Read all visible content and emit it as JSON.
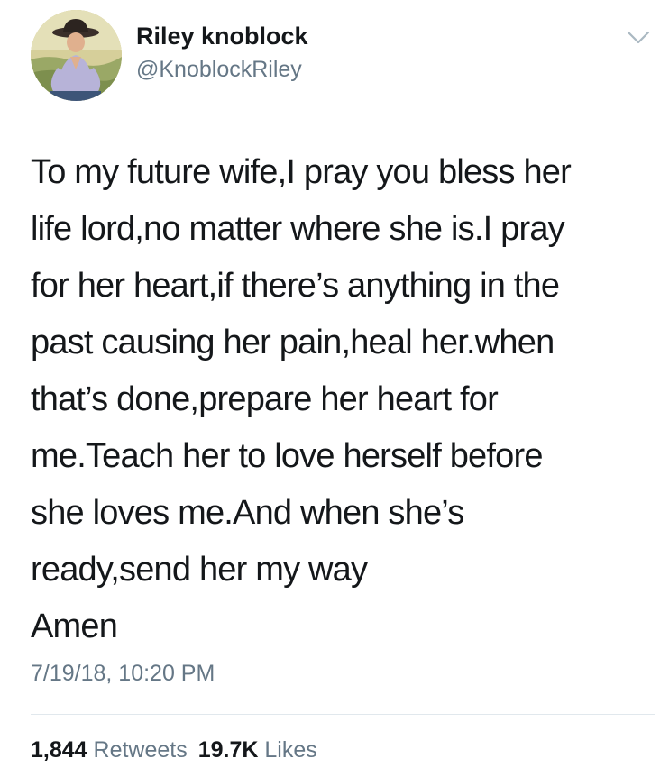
{
  "tweet": {
    "author_name": "Riley knoblock",
    "author_handle": "@KnoblockRiley",
    "text_lines": [
      "To my future wife,I pray you bless her",
      "life lord,no matter where she is.I pray",
      "for her heart,if there’s anything in the",
      "past causing her pain,heal her.when",
      "that’s done,prepare her heart for",
      "me.Teach her to love herself before",
      "she loves me.And when she’s",
      "ready,send her my way",
      "Amen"
    ],
    "timestamp": "7/19/18, 10:20 PM",
    "retweets_count": "1,844",
    "retweets_label": "Retweets",
    "likes_count": "19.7K",
    "likes_label": "Likes",
    "menu_icon": "chevron-down-icon"
  },
  "colors": {
    "text_primary": "#14171a",
    "text_secondary": "#657786",
    "divider": "#e1e8ed",
    "chevron": "#aab8c2"
  }
}
